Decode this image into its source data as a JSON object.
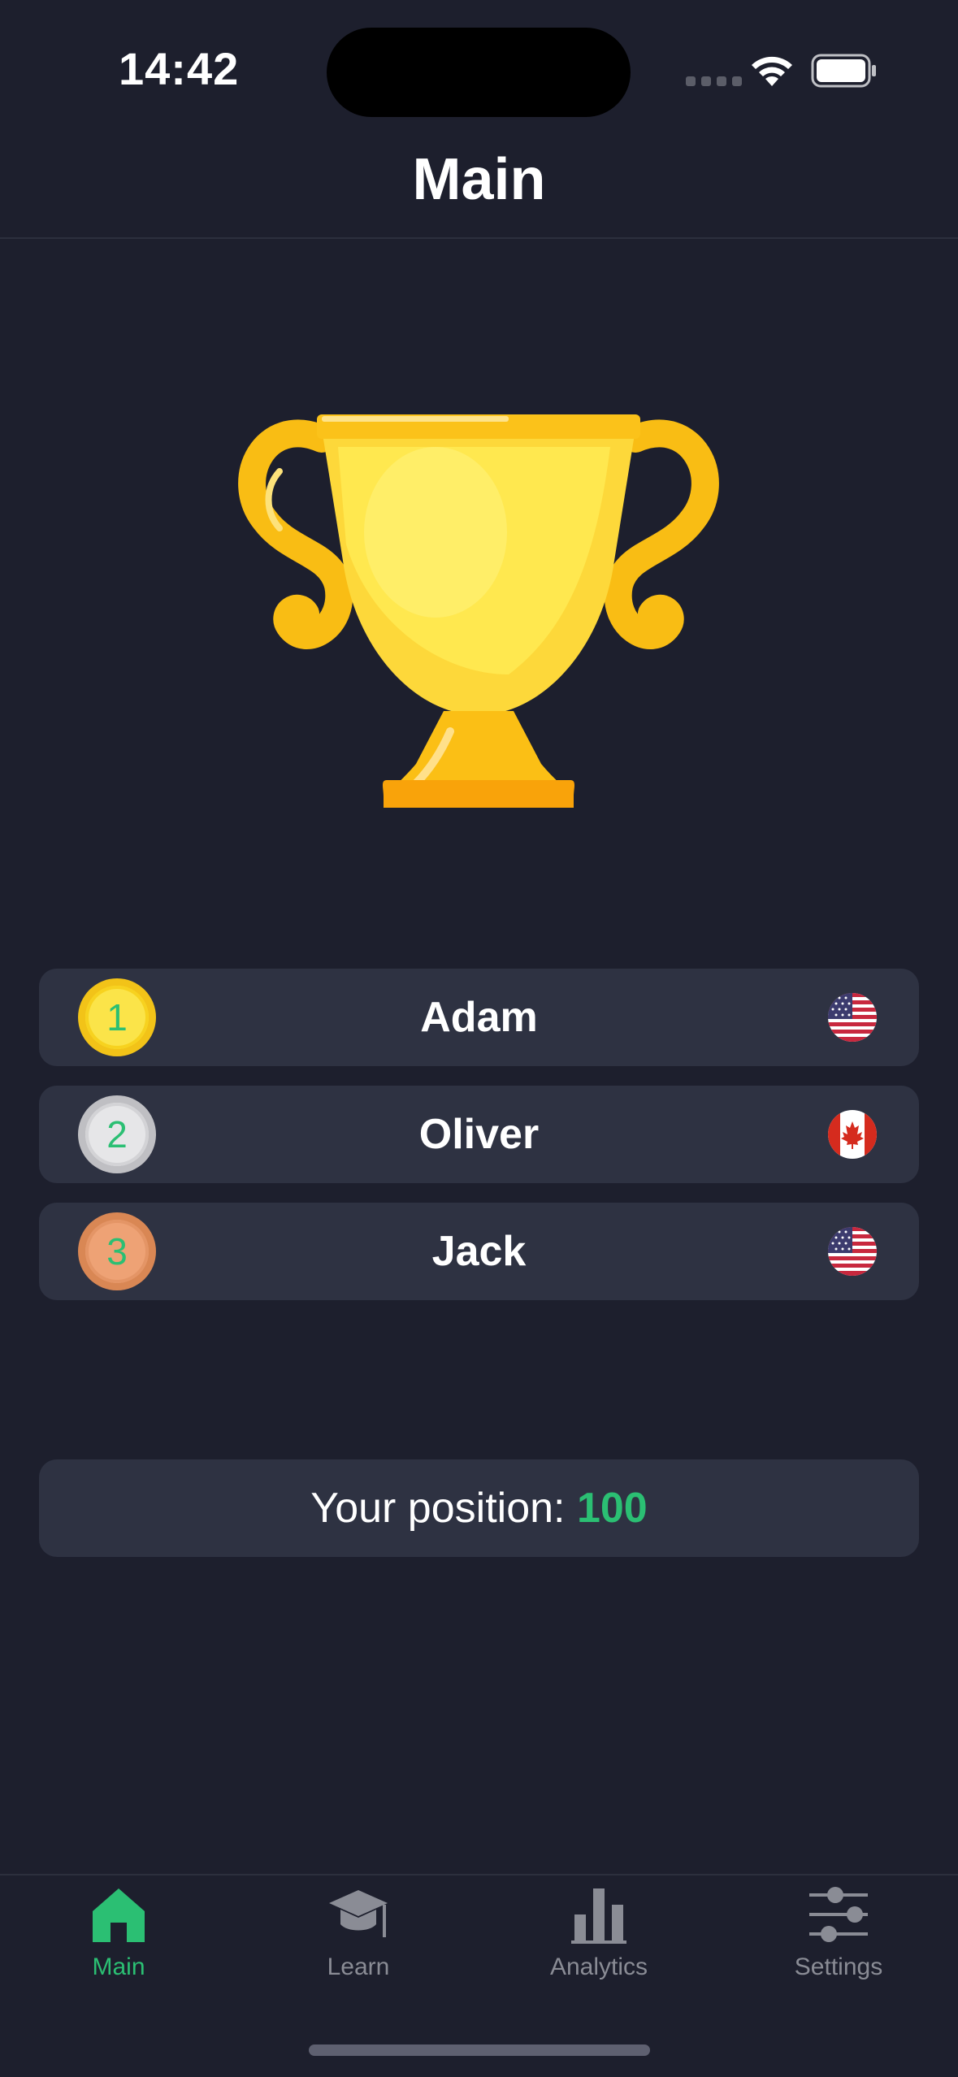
{
  "status_bar": {
    "time": "14:42"
  },
  "header": {
    "title": "Main"
  },
  "leaderboard": [
    {
      "rank": "1",
      "name": "Adam",
      "medal": "gold",
      "flag": "us-flag"
    },
    {
      "rank": "2",
      "name": "Oliver",
      "medal": "silver",
      "flag": "canada-flag"
    },
    {
      "rank": "3",
      "name": "Jack",
      "medal": "bronze",
      "flag": "us-flag"
    }
  ],
  "position": {
    "label": "Your position: ",
    "value": "100"
  },
  "tabs": [
    {
      "label": "Main",
      "icon": "home-icon",
      "active": true
    },
    {
      "label": "Learn",
      "icon": "graduation-cap-icon",
      "active": false
    },
    {
      "label": "Analytics",
      "icon": "bar-chart-icon",
      "active": false
    },
    {
      "label": "Settings",
      "icon": "sliders-icon",
      "active": false
    }
  ],
  "colors": {
    "background": "#1d1f2d",
    "card": "#2e3242",
    "accent": "#2bbf73",
    "inactive": "#8a8c95"
  }
}
